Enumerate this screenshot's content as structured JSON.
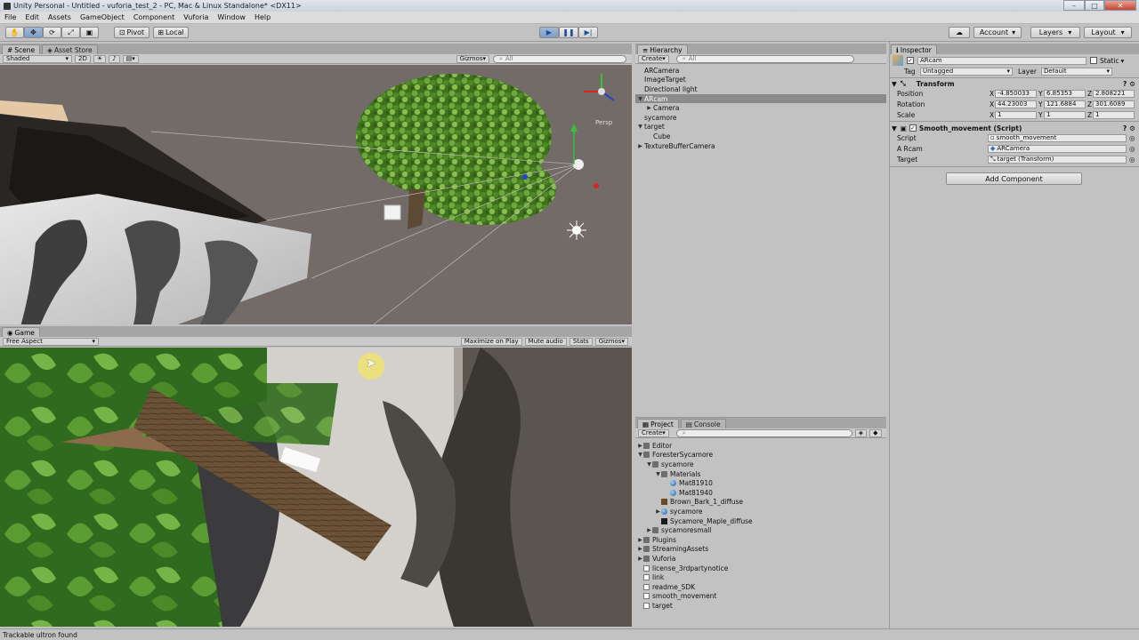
{
  "window": {
    "title": "Unity Personal - Untitled - vuforia_test_2 - PC, Mac & Linux Standalone* <DX11>",
    "minimize": "–",
    "maximize": "□",
    "close": "✕"
  },
  "menu": [
    "File",
    "Edit",
    "Assets",
    "GameObject",
    "Component",
    "Vuforia",
    "Window",
    "Help"
  ],
  "toolbar": {
    "pivot": "Pivot",
    "local": "Local",
    "account": "Account",
    "layers": "Layers",
    "layout": "Layout"
  },
  "scene": {
    "tabs": [
      "Scene",
      "Asset Store"
    ],
    "shading": "Shaded",
    "mode2d": "2D",
    "gizmos": "Gizmos",
    "search": "All",
    "persp": "Persp"
  },
  "game": {
    "tab": "Game",
    "aspect": "Free Aspect",
    "buttons": [
      "Maximize on Play",
      "Mute audio",
      "Stats",
      "Gizmos"
    ]
  },
  "hierarchy": {
    "tab": "Hierarchy",
    "create": "Create",
    "search": "All",
    "items": [
      {
        "label": "ARCamera",
        "depth": 0
      },
      {
        "label": "ImageTarget",
        "depth": 0
      },
      {
        "label": "Directional light",
        "depth": 0
      },
      {
        "label": "ARcam",
        "depth": 0,
        "arrow": "▼",
        "selected": true
      },
      {
        "label": "Camera",
        "depth": 1,
        "arrow": "▶"
      },
      {
        "label": "sycamore",
        "depth": 0
      },
      {
        "label": "target",
        "depth": 0,
        "arrow": "▼"
      },
      {
        "label": "Cube",
        "depth": 1
      },
      {
        "label": "TextureBufferCamera",
        "depth": 0,
        "arrow": "▶"
      }
    ]
  },
  "project": {
    "tabs": [
      "Project",
      "Console"
    ],
    "create": "Create",
    "items": [
      {
        "label": "Editor",
        "depth": 0,
        "icon": "folder",
        "arrow": "▶"
      },
      {
        "label": "ForesterSycamore",
        "depth": 0,
        "icon": "folder",
        "arrow": "▼"
      },
      {
        "label": "sycamore",
        "depth": 1,
        "icon": "folder",
        "arrow": "▼"
      },
      {
        "label": "Materials",
        "depth": 2,
        "icon": "folder",
        "arrow": "▼"
      },
      {
        "label": "Mat81910",
        "depth": 3,
        "icon": "mat"
      },
      {
        "label": "Mat81940",
        "depth": 3,
        "icon": "mat"
      },
      {
        "label": "Brown_Bark_1_diffuse",
        "depth": 2,
        "icon": "tex"
      },
      {
        "label": "sycamore",
        "depth": 2,
        "icon": "mat",
        "arrow": "▶"
      },
      {
        "label": "Sycamore_Maple_diffuse",
        "depth": 2,
        "icon": "tex2"
      },
      {
        "label": "sycamoresmall",
        "depth": 1,
        "icon": "folder",
        "arrow": "▶"
      },
      {
        "label": "Plugins",
        "depth": 0,
        "icon": "folder",
        "arrow": "▶"
      },
      {
        "label": "StreamingAssets",
        "depth": 0,
        "icon": "folder",
        "arrow": "▶"
      },
      {
        "label": "Vuforia",
        "depth": 0,
        "icon": "folder",
        "arrow": "▶"
      },
      {
        "label": "license_3rdpartynotice",
        "depth": 0,
        "icon": "doc"
      },
      {
        "label": "link",
        "depth": 0,
        "icon": "doc"
      },
      {
        "label": "readme_SDK",
        "depth": 0,
        "icon": "doc"
      },
      {
        "label": "smooth_movement",
        "depth": 0,
        "icon": "doc"
      },
      {
        "label": "target",
        "depth": 0,
        "icon": "doc"
      }
    ]
  },
  "inspector": {
    "tab": "Inspector",
    "object_name": "ARcam",
    "static": "Static",
    "tag_label": "Tag",
    "tag": "Untagged",
    "layer_label": "Layer",
    "layer": "Default",
    "transform": {
      "title": "Transform",
      "position_label": "Position",
      "rotation_label": "Rotation",
      "scale_label": "Scale",
      "position": [
        "-4.850033",
        "6.85353",
        "2.808221"
      ],
      "rotation": [
        "44.23003",
        "121.6884",
        "301.6089"
      ],
      "scale": [
        "1",
        "1",
        "1"
      ]
    },
    "script_comp": {
      "title": "Smooth_movement (Script)",
      "script_label": "Script",
      "script": "smooth_movement",
      "arcam_label": "A Rcam",
      "arcam": "ARCamera",
      "target_label": "Target",
      "target": "target (Transform)"
    },
    "add_component": "Add Component"
  },
  "status": "Trackable ultron found"
}
